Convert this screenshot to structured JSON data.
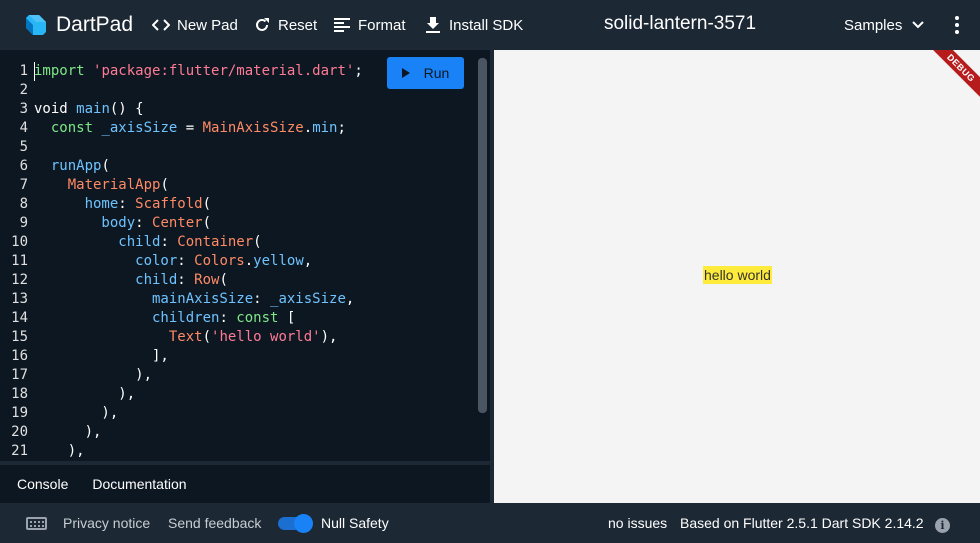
{
  "header": {
    "app_name": "DartPad",
    "new_pad_label": "New Pad",
    "reset_label": "Reset",
    "format_label": "Format",
    "install_sdk_label": "Install SDK",
    "pad_title": "solid-lantern-3571",
    "samples_label": "Samples",
    "icons": {
      "logo": "dart-logo-icon",
      "new_pad": "code-brackets-icon",
      "reset": "refresh-icon",
      "format": "format-lines-icon",
      "install": "download-icon",
      "samples": "chevron-down-icon",
      "menu": "more-vert-icon"
    }
  },
  "editor": {
    "run_label": "Run",
    "line_numbers": [
      "1",
      "2",
      "3",
      "4",
      "5",
      "6",
      "7",
      "8",
      "9",
      "10",
      "11",
      "12",
      "13",
      "14",
      "15",
      "16",
      "17",
      "18",
      "19",
      "20",
      "21"
    ],
    "code_lines": [
      [
        {
          "t": "import ",
          "c": "k"
        },
        {
          "t": "'package:flutter/material.dart'",
          "c": "s"
        },
        {
          "t": ";",
          "c": "p"
        }
      ],
      [],
      [
        {
          "t": "void ",
          "c": "p"
        },
        {
          "t": "main",
          "c": "f"
        },
        {
          "t": "() {",
          "c": "p"
        }
      ],
      [
        {
          "t": "  const ",
          "c": "k"
        },
        {
          "t": "_axisSize",
          "c": "f"
        },
        {
          "t": " = ",
          "c": "p"
        },
        {
          "t": "MainAxisSize",
          "c": "c"
        },
        {
          "t": ".",
          "c": "p"
        },
        {
          "t": "min",
          "c": "f"
        },
        {
          "t": ";",
          "c": "p"
        }
      ],
      [],
      [
        {
          "t": "  runApp",
          "c": "f"
        },
        {
          "t": "(",
          "c": "p"
        }
      ],
      [
        {
          "t": "    MaterialApp",
          "c": "c"
        },
        {
          "t": "(",
          "c": "p"
        }
      ],
      [
        {
          "t": "      home",
          "c": "f"
        },
        {
          "t": ": ",
          "c": "p"
        },
        {
          "t": "Scaffold",
          "c": "c"
        },
        {
          "t": "(",
          "c": "p"
        }
      ],
      [
        {
          "t": "        body",
          "c": "f"
        },
        {
          "t": ": ",
          "c": "p"
        },
        {
          "t": "Center",
          "c": "c"
        },
        {
          "t": "(",
          "c": "p"
        }
      ],
      [
        {
          "t": "          child",
          "c": "f"
        },
        {
          "t": ": ",
          "c": "p"
        },
        {
          "t": "Container",
          "c": "c"
        },
        {
          "t": "(",
          "c": "p"
        }
      ],
      [
        {
          "t": "            color",
          "c": "f"
        },
        {
          "t": ": ",
          "c": "p"
        },
        {
          "t": "Colors",
          "c": "c"
        },
        {
          "t": ".",
          "c": "p"
        },
        {
          "t": "yellow",
          "c": "f"
        },
        {
          "t": ",",
          "c": "p"
        }
      ],
      [
        {
          "t": "            child",
          "c": "f"
        },
        {
          "t": ": ",
          "c": "p"
        },
        {
          "t": "Row",
          "c": "c"
        },
        {
          "t": "(",
          "c": "p"
        }
      ],
      [
        {
          "t": "              mainAxisSize",
          "c": "f"
        },
        {
          "t": ": ",
          "c": "p"
        },
        {
          "t": "_axisSize",
          "c": "f"
        },
        {
          "t": ",",
          "c": "p"
        }
      ],
      [
        {
          "t": "              children",
          "c": "f"
        },
        {
          "t": ": ",
          "c": "p"
        },
        {
          "t": "const ",
          "c": "k"
        },
        {
          "t": "[",
          "c": "p"
        }
      ],
      [
        {
          "t": "                Text",
          "c": "c"
        },
        {
          "t": "(",
          "c": "p"
        },
        {
          "t": "'hello world'",
          "c": "s"
        },
        {
          "t": "),",
          "c": "p"
        }
      ],
      [
        {
          "t": "              ],",
          "c": "p"
        }
      ],
      [
        {
          "t": "            ),",
          "c": "p"
        }
      ],
      [
        {
          "t": "          ),",
          "c": "p"
        }
      ],
      [
        {
          "t": "        ),",
          "c": "p"
        }
      ],
      [
        {
          "t": "      ),",
          "c": "p"
        }
      ],
      [
        {
          "t": "    ),",
          "c": "p"
        }
      ]
    ]
  },
  "bottom_tabs": {
    "console_label": "Console",
    "documentation_label": "Documentation"
  },
  "preview": {
    "output_text": "hello world",
    "debug_banner": "DEBUG"
  },
  "footer": {
    "privacy_label": "Privacy notice",
    "feedback_label": "Send feedback",
    "null_safety_label": "Null Safety",
    "null_safety_enabled": true,
    "issues_label": "no issues",
    "version_label": "Based on Flutter 2.5.1 Dart SDK 2.14.2",
    "icons": {
      "keyboard": "keyboard-icon",
      "info": "info-icon"
    }
  },
  "colors": {
    "run_button": "#1a82f7",
    "editor_bg": "#0d1721",
    "chrome_bg": "#1c2834",
    "preview_bg": "#f4f4f4",
    "highlight": "#ffeb3b",
    "debug_banner": "#b71c1c"
  }
}
